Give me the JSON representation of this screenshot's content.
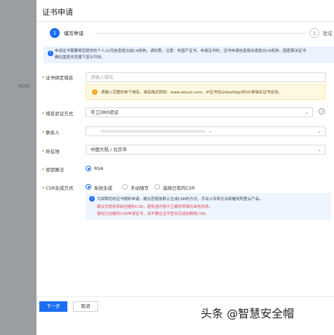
{
  "background": {
    "side_text": "绑定域"
  },
  "dialog": {
    "title": "证书申请"
  },
  "steps": [
    {
      "number": "1",
      "label": "填写申请"
    },
    {
      "number": "2",
      "label": "验证"
    }
  ],
  "notice": {
    "text": "申请证书需要将您提供的个人/公司信息提交给CA机构，请知悉。注意：非国产证书，申请证书时，证书申请信息将出境提交CA机构，国密算法证书\n确在国密浏览器下显示可信。"
  },
  "form": {
    "domain": {
      "label": "证书绑定域名",
      "placeholder": "请输入域名",
      "tip": "请输入完整的单个域名，域名格式例如：www.aliyun.com，IP证书仅GlobalSign的OV单域名证书支持。"
    },
    "verify_method": {
      "label": "域名验证方式",
      "value": "手工DNS验证",
      "help": "?"
    },
    "contact": {
      "label": "联系人",
      "value": "-"
    },
    "location": {
      "label": "所在地",
      "value": "中国大陆 / 北京市"
    },
    "algorithm": {
      "label": "密钥算法",
      "options": [
        {
          "label": "RSA",
          "checked": true
        }
      ]
    },
    "csr": {
      "label": "CSR生成方式",
      "options": [
        {
          "label": "系统生成",
          "checked": true
        },
        {
          "label": "手动填写",
          "checked": false
        },
        {
          "label": "选择已有的CSR",
          "checked": false
        }
      ],
      "info": {
        "line1": "为保障您的证书顺利申请，建议您使用默认生成CSR的方式，手动上传将无法部署到阿里云产品。",
        "line2": "建议您使用系统创建的CSR，避免因内容不正确而导致的审核失败。",
        "line3": "使用已创建的CSR申请证书，请不要在证书签发完成前删除CSR。"
      }
    }
  },
  "footer": {
    "next": "下一步",
    "cancel": "取消"
  },
  "watermark": "头条 @智慧安全帽",
  "colors": {
    "accent": "#1a6ef0",
    "error": "#e34d59",
    "tip_bg": "#fff8e1"
  }
}
